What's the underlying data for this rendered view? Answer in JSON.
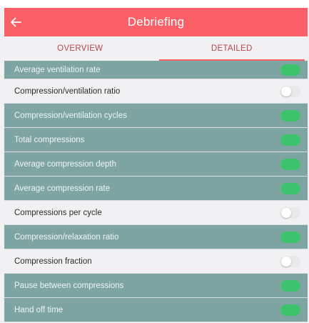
{
  "header": {
    "title": "Debriefing",
    "back_icon": "arrow-left-icon"
  },
  "tabs": [
    {
      "label": "OVERVIEW",
      "active": false
    },
    {
      "label": "DETAILED",
      "active": true
    }
  ],
  "settings": [
    {
      "label": "Average ventilation rate",
      "enabled": true
    },
    {
      "label": "Compression/ventilation ratio",
      "enabled": false
    },
    {
      "label": "Compression/ventilation cycles",
      "enabled": true
    },
    {
      "label": "Total compressions",
      "enabled": true
    },
    {
      "label": "Average compression depth",
      "enabled": true
    },
    {
      "label": "Average compression rate",
      "enabled": true
    },
    {
      "label": "Compressions per cycle",
      "enabled": false
    },
    {
      "label": "Compression/relaxation ratio",
      "enabled": true
    },
    {
      "label": "Compression fraction",
      "enabled": false
    },
    {
      "label": "Pause between compressions",
      "enabled": true
    },
    {
      "label": "Hand off time",
      "enabled": true
    }
  ],
  "colors": {
    "header": "#fb6068",
    "enabled_row": "#7fa5a3",
    "disabled_row": "#f1f1f4",
    "toggle_on": "#3ec36d"
  }
}
